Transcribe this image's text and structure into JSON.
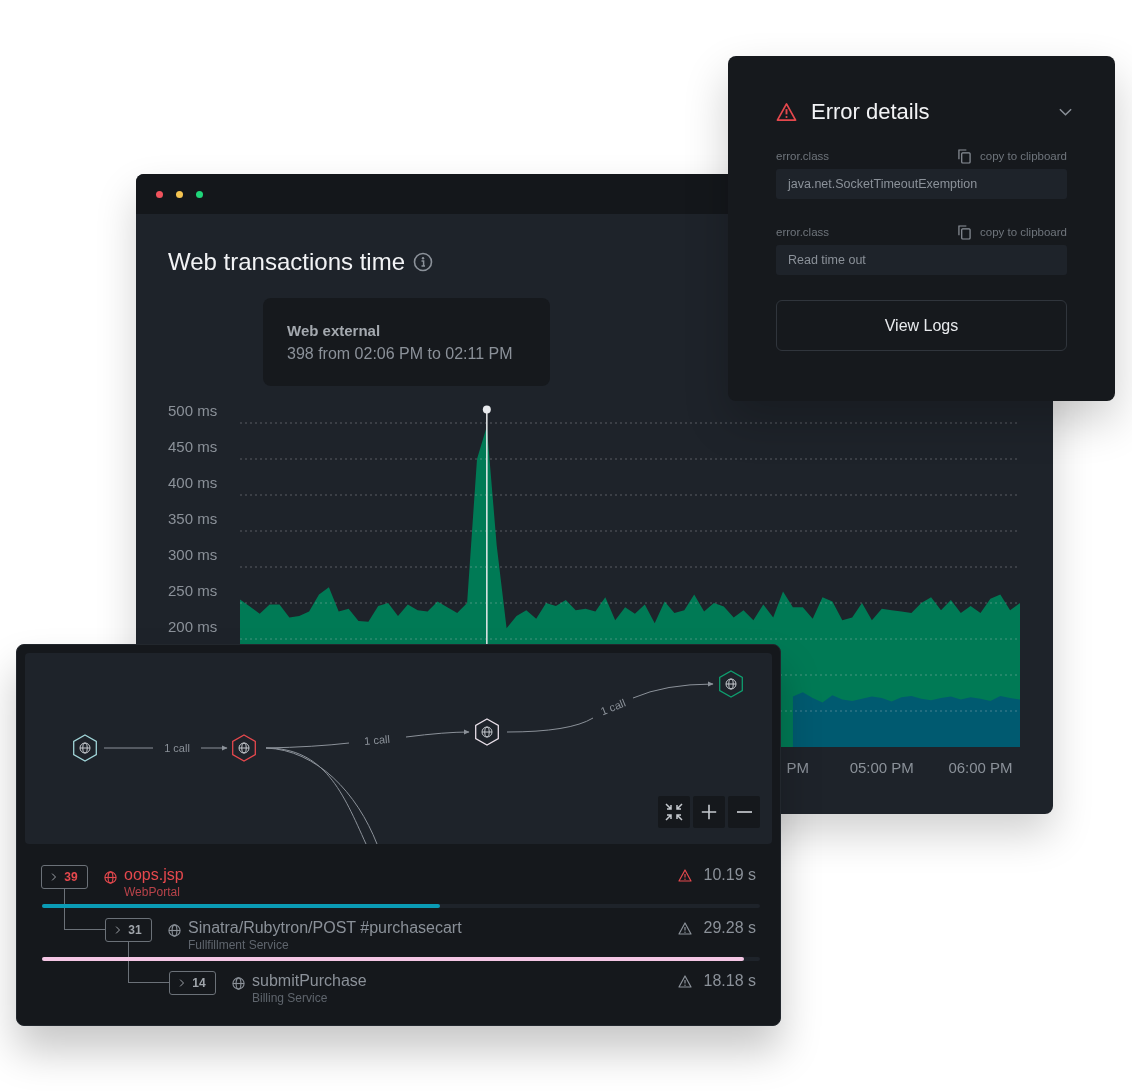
{
  "error_panel": {
    "title": "Error details",
    "expanded": true,
    "fields": [
      {
        "label": "error.class",
        "copy_label": "copy to clipboard",
        "value": "java.net.SocketTimeoutExemption"
      },
      {
        "label": "error.class",
        "copy_label": "copy to clipboard",
        "value": "Read time out"
      }
    ],
    "button": "View Logs"
  },
  "chart_window": {
    "title": "Web transactions time",
    "tooltip": {
      "title": "Web external",
      "text": "398 from 02:06 PM to 02:11 PM"
    },
    "chart_data": {
      "type": "area",
      "stacked": false,
      "grid": true,
      "ref_lines": [
        {
          "axis": "x",
          "value": 13
        }
      ],
      "x": [
        10.5,
        10.6,
        10.7,
        10.8,
        10.9,
        11,
        11.1,
        11.2,
        11.3,
        11.4,
        11.5,
        11.6,
        11.7,
        11.8,
        11.9,
        12,
        12.1,
        12.2,
        12.3,
        12.4,
        12.5,
        12.6,
        12.7,
        12.8,
        12.9,
        13,
        13.1,
        13.2,
        13.3,
        13.4,
        13.5,
        13.6,
        13.7,
        13.8,
        13.9,
        14,
        14.1,
        14.2,
        14.3,
        14.4,
        14.5,
        14.6,
        14.7,
        14.8,
        14.9,
        15,
        15.1,
        15.2,
        15.3,
        15.4,
        15.5,
        15.6,
        15.7,
        15.8,
        15.9,
        16,
        16.1,
        16.2,
        16.3,
        16.4,
        16.5,
        16.6,
        16.7,
        16.8,
        16.9,
        17,
        17.1,
        17.2,
        17.3,
        17.4,
        17.5,
        17.6,
        17.7,
        17.8,
        17.9,
        18,
        18.1,
        18.2,
        18.3,
        18.4
      ],
      "xlim": [
        10.5,
        18.4
      ],
      "ylim": [
        50,
        500
      ],
      "yticks": [
        {
          "value": 500,
          "label": "500 ms"
        },
        {
          "value": 450,
          "label": "450 ms"
        },
        {
          "value": 400,
          "label": "400 ms"
        },
        {
          "value": 350,
          "label": "350 ms"
        },
        {
          "value": 300,
          "label": "300 ms"
        },
        {
          "value": 250,
          "label": "250 ms"
        },
        {
          "value": 200,
          "label": "200 ms"
        }
      ],
      "xticks": [
        {
          "value": 16.15,
          "label": "PM"
        },
        {
          "value": 17,
          "label": "05:00 PM"
        },
        {
          "value": 18,
          "label": "06:00 PM"
        }
      ],
      "series": [
        {
          "color": "#007a55",
          "values": [
            255,
            245,
            235,
            248,
            248,
            230,
            232,
            238,
            262,
            272,
            238,
            242,
            225,
            224,
            246,
            250,
            232,
            248,
            240,
            238,
            252,
            244,
            236,
            250,
            450,
            495,
            330,
            215,
            232,
            240,
            228,
            250,
            246,
            254,
            240,
            242,
            238,
            258,
            226,
            244,
            235,
            248,
            222,
            252,
            236,
            240,
            262,
            238,
            250,
            245,
            230,
            240,
            226,
            248,
            230,
            266,
            244,
            244,
            228,
            258,
            252,
            226,
            230,
            250,
            226,
            242,
            240,
            238,
            236,
            250,
            258,
            240,
            254,
            236,
            246,
            236,
            256,
            262,
            240,
            250
          ]
        },
        {
          "color": "#005a70",
          "values": [
            null,
            null,
            null,
            null,
            null,
            null,
            null,
            null,
            null,
            null,
            null,
            null,
            null,
            null,
            null,
            null,
            null,
            null,
            null,
            null,
            null,
            null,
            null,
            null,
            null,
            null,
            null,
            null,
            null,
            null,
            null,
            null,
            null,
            null,
            null,
            null,
            null,
            null,
            null,
            null,
            null,
            null,
            null,
            null,
            null,
            null,
            null,
            null,
            null,
            null,
            null,
            null,
            null,
            null,
            null,
            null,
            120,
            126,
            118,
            112,
            122,
            116,
            114,
            117,
            120,
            118,
            113,
            119,
            121,
            117,
            115,
            118,
            120,
            116,
            119,
            117,
            114,
            121,
            118,
            116
          ]
        }
      ]
    }
  },
  "service_map": {
    "nodes": [
      {
        "color": "#9fd3d6"
      },
      {
        "color": "#e5484d"
      },
      {
        "color": "#e6dde6"
      },
      {
        "color": "#0f9d6e"
      }
    ],
    "edges": [
      {
        "label": "1 call"
      },
      {
        "label": "1 call"
      },
      {
        "label": "1 call"
      }
    ]
  },
  "trace": [
    {
      "count": "39",
      "name": "oops.jsp",
      "service": "WebPortal",
      "duration": "10.19 s",
      "error": true,
      "level": 0.555,
      "color": "#0a9bb5",
      "children": [
        {
          "count": "31",
          "name": "Sinatra/Rubytron/POST #purchasecart",
          "service": "Fullfillment Service",
          "duration": "29.28 s",
          "error": false,
          "level": 0.978,
          "color": "#f4c6e4",
          "children": [
            {
              "count": "14",
              "name": "submitPurchase",
              "service": "Billing Service",
              "duration": "18.18 s",
              "error": false
            }
          ]
        }
      ]
    }
  ]
}
